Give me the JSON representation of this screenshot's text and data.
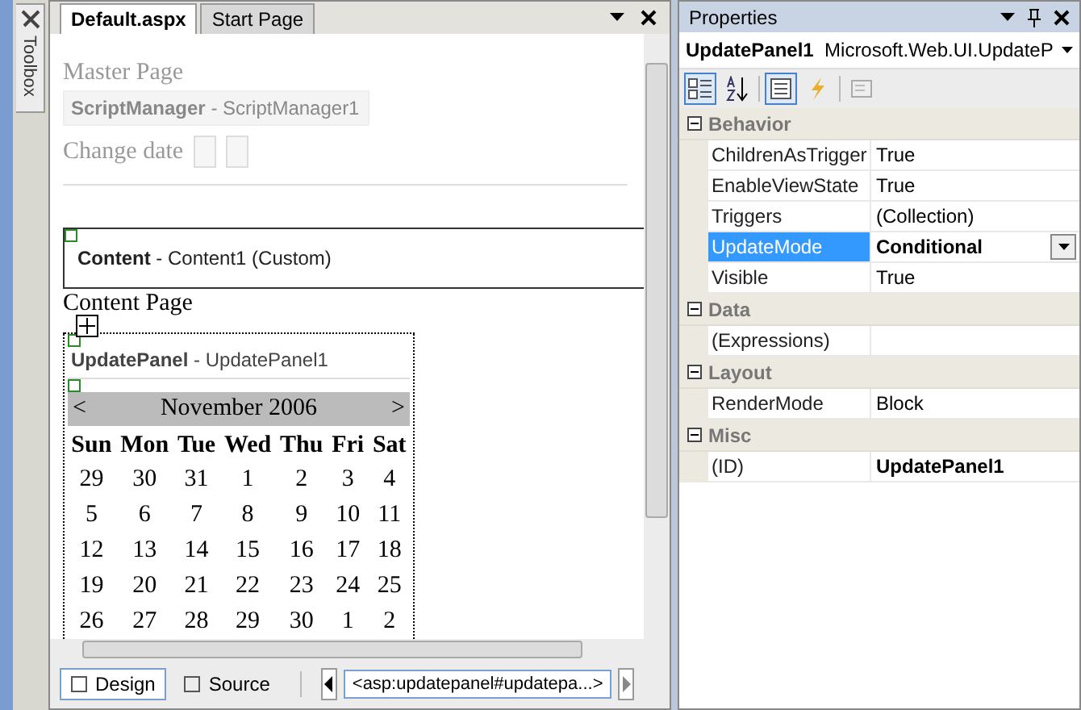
{
  "toolbox": {
    "label": "Toolbox"
  },
  "editor": {
    "tabs": [
      {
        "label": "Default.aspx",
        "selected": true
      },
      {
        "label": "Start Page",
        "selected": false
      }
    ],
    "master": {
      "title": "Master Page",
      "script_manager": "**ScriptManager** - ScriptManager1",
      "change_date": "Change date"
    },
    "content": {
      "header": "**Content** - Content1 (Custom)",
      "text": "Content Page"
    },
    "update_panel": "**UpdatePanel** - UpdatePanel1",
    "calendar": {
      "prev": "<",
      "title": "November 2006",
      "next": ">",
      "days": [
        "Sun",
        "Mon",
        "Tue",
        "Wed",
        "Thu",
        "Fri",
        "Sat"
      ],
      "weeks": [
        [
          "29",
          "30",
          "31",
          "1",
          "2",
          "3",
          "4"
        ],
        [
          "5",
          "6",
          "7",
          "8",
          "9",
          "10",
          "11"
        ],
        [
          "12",
          "13",
          "14",
          "15",
          "16",
          "17",
          "18"
        ],
        [
          "19",
          "20",
          "21",
          "22",
          "23",
          "24",
          "25"
        ],
        [
          "26",
          "27",
          "28",
          "29",
          "30",
          "1",
          "2"
        ]
      ]
    },
    "view_tabs": [
      {
        "label": "Design",
        "selected": true
      },
      {
        "label": "Source",
        "selected": false
      }
    ],
    "breadcrumb": "<asp:updatepanel#updatepa...>"
  },
  "properties": {
    "title": "Properties",
    "object_name": "UpdatePanel1",
    "object_type": "Microsoft.Web.UI.UpdateP",
    "toolbar": [
      {
        "kind": "categorized",
        "selected": true
      },
      {
        "kind": "alphabetical",
        "selected": false
      },
      {
        "kind": "properties",
        "selected": true
      },
      {
        "kind": "events",
        "selected": false
      },
      {
        "kind": "pages",
        "selected": false
      }
    ],
    "categories": [
      {
        "name": "Behavior",
        "expanded": true,
        "props": [
          {
            "name": "ChildrenAsTrigger",
            "value": "True",
            "selected": false,
            "modified": false
          },
          {
            "name": "EnableViewState",
            "value": "True",
            "selected": false,
            "modified": false
          },
          {
            "name": "Triggers",
            "value": "(Collection)",
            "selected": false,
            "modified": false
          },
          {
            "name": "UpdateMode",
            "value": "Conditional",
            "selected": true,
            "modified": true,
            "dropdown": true
          },
          {
            "name": "Visible",
            "value": "True",
            "selected": false,
            "modified": false
          }
        ]
      },
      {
        "name": "Data",
        "expanded": true,
        "props": [
          {
            "name": "(Expressions)",
            "selected": false
          }
        ]
      },
      {
        "name": "Layout",
        "expanded": true,
        "props": [
          {
            "name": "RenderMode",
            "value": "Block",
            "selected": false,
            "modified": false
          }
        ]
      },
      {
        "name": "Misc",
        "expanded": true,
        "props": [
          {
            "name": "(ID)",
            "value": "UpdatePanel1",
            "selected": false,
            "modified": true
          }
        ]
      }
    ]
  }
}
